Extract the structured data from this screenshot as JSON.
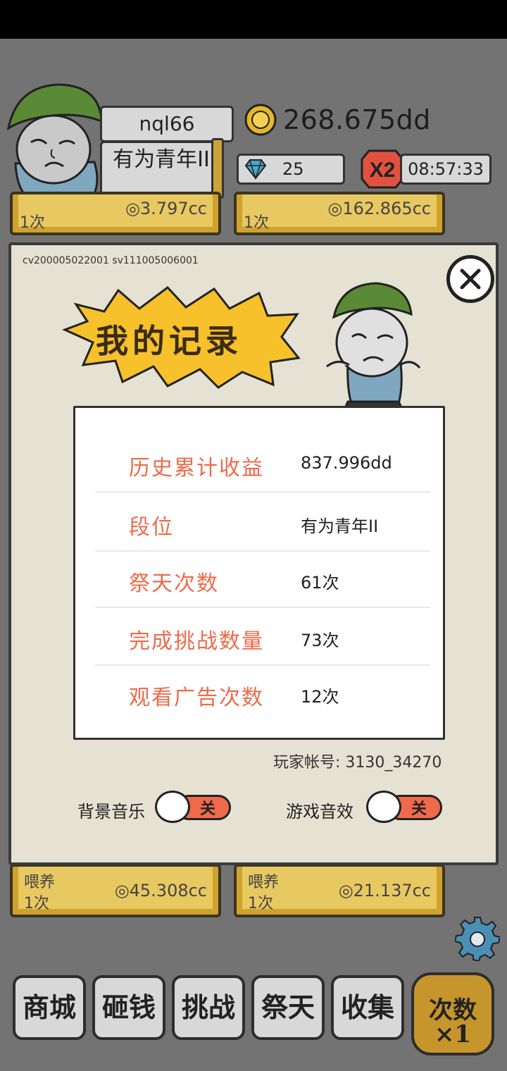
{
  "header": {
    "player_name": "nql66",
    "rank": "有为青年II",
    "coins": "268.675dd",
    "gems": "25",
    "boost": "X2",
    "timer": "08:57:33"
  },
  "background_cards": [
    {
      "count": "1次",
      "value": "◎3.797cc"
    },
    {
      "count": "1次",
      "value": "◎162.865cc"
    },
    {
      "label": "喂养",
      "count": "1次",
      "value": "◎45.308cc"
    },
    {
      "label": "喂养",
      "count": "1次",
      "value": "◎21.137cc"
    }
  ],
  "modal": {
    "version": "cv200005022001 sv111005006001",
    "title": "我的记录",
    "stats": [
      {
        "label": "历史累计收益",
        "value": "837.996dd"
      },
      {
        "label": "段位",
        "value": "有为青年II"
      },
      {
        "label": "祭天次数",
        "value": "61次"
      },
      {
        "label": "完成挑战数量",
        "value": "73次"
      },
      {
        "label": "观看广告次数",
        "value": "12次"
      }
    ],
    "account": "玩家帐号: 3130_34270",
    "settings": {
      "music_label": "背景音乐",
      "music_state": "关",
      "sfx_label": "游戏音效",
      "sfx_state": "关"
    }
  },
  "nav": {
    "shop": "商城",
    "smash": "砸钱",
    "challenge": "挑战",
    "worship": "祭天",
    "collect": "收集",
    "count_line1": "次数",
    "count_line2": "×1"
  },
  "colors": {
    "accent": "#ef6a4a",
    "gold": "#cfa22e",
    "panel": "#e6e2d3"
  }
}
